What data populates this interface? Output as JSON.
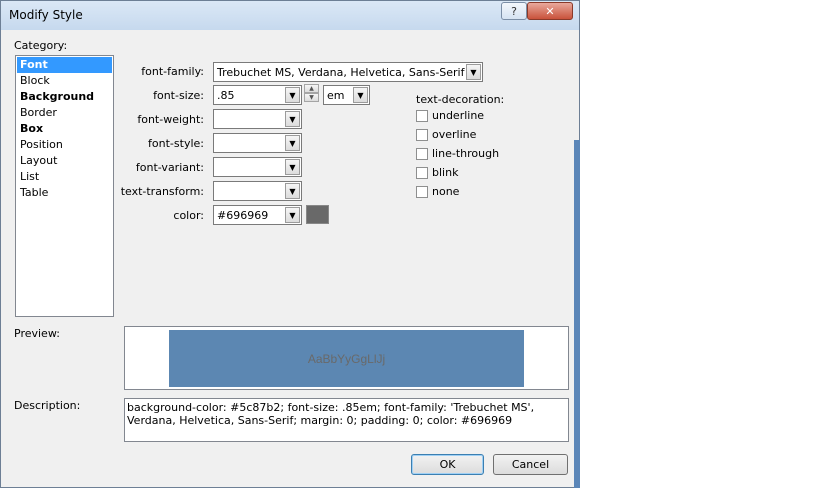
{
  "window": {
    "title": "Modify Style",
    "help_glyph": "?",
    "close_glyph": "✕"
  },
  "category": {
    "label": "Category:",
    "items": [
      {
        "label": "Font",
        "selected": true,
        "bold": true
      },
      {
        "label": "Block",
        "selected": false,
        "bold": false
      },
      {
        "label": "Background",
        "selected": false,
        "bold": true
      },
      {
        "label": "Border",
        "selected": false,
        "bold": false
      },
      {
        "label": "Box",
        "selected": false,
        "bold": true
      },
      {
        "label": "Position",
        "selected": false,
        "bold": false
      },
      {
        "label": "Layout",
        "selected": false,
        "bold": false
      },
      {
        "label": "List",
        "selected": false,
        "bold": false
      },
      {
        "label": "Table",
        "selected": false,
        "bold": false
      }
    ]
  },
  "font": {
    "family_label": "font-family:",
    "family_value": "Trebuchet MS, Verdana, Helvetica, Sans-Serif",
    "size_label": "font-size:",
    "size_value": ".85",
    "size_unit": "em",
    "weight_label": "font-weight:",
    "weight_value": "",
    "style_label": "font-style:",
    "style_value": "",
    "variant_label": "font-variant:",
    "variant_value": "",
    "transform_label": "text-transform:",
    "transform_value": "",
    "color_label": "color:",
    "color_value": "#696969",
    "color_swatch": "#696969"
  },
  "decoration": {
    "label": "text-decoration:",
    "options": [
      {
        "label": "underline",
        "checked": false
      },
      {
        "label": "overline",
        "checked": false
      },
      {
        "label": "line-through",
        "checked": false
      },
      {
        "label": "blink",
        "checked": false
      },
      {
        "label": "none",
        "checked": false
      }
    ]
  },
  "preview": {
    "label": "Preview:",
    "sample_text": "AaBbYyGgLlJj",
    "background": "#5c87b2",
    "text_color": "#696969"
  },
  "description": {
    "label": "Description:",
    "text": "background-color: #5c87b2; font-size: .85em; font-family: 'Trebuchet MS', Verdana, Helvetica, Sans-Serif; margin: 0; padding: 0; color: #696969"
  },
  "buttons": {
    "ok": "OK",
    "cancel": "Cancel"
  },
  "colors": {
    "selection": "#3399ff",
    "accent_strip": "#5b86b8"
  }
}
